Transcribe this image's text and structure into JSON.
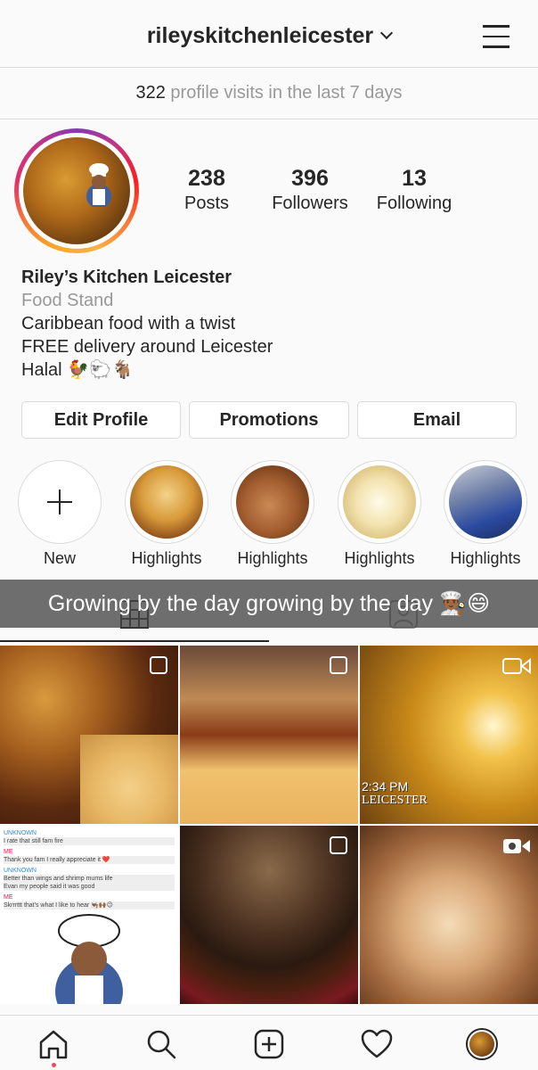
{
  "header": {
    "username": "rileyskitchenleicester"
  },
  "insights": {
    "count": "322",
    "text": "profile visits in the last 7 days"
  },
  "stats": [
    {
      "value": "238",
      "label": "Posts"
    },
    {
      "value": "396",
      "label": "Followers"
    },
    {
      "value": "13",
      "label": "Following"
    }
  ],
  "bio": {
    "name": "Riley’s Kitchen Leicester",
    "category": "Food Stand",
    "lines": [
      "Caribbean food with a twist",
      "FREE delivery around Leicester",
      "Halal 🐓🐑🐐"
    ]
  },
  "buttons": {
    "edit": "Edit Profile",
    "promotions": "Promotions",
    "email": "Email"
  },
  "highlights": [
    {
      "label": "New"
    },
    {
      "label": "Highlights"
    },
    {
      "label": "Highlights"
    },
    {
      "label": "Highlights"
    },
    {
      "label": "Highlights"
    }
  ],
  "caption": "Growing by the day growing by the day 👨🏾‍🍳😄",
  "grid_overlays": {
    "timestamp": "2:34 PM",
    "location": "LEICESTER",
    "chat": [
      {
        "sender": "UNKNOWN",
        "text": "I rate that still fam fire"
      },
      {
        "sender": "ME",
        "text": "Thank you fam I really appreciate it ❤️"
      },
      {
        "sender": "UNKNOWN",
        "text": "Better than wings and shrimp mums life"
      },
      {
        "sender": "",
        "text": "Evan my people said it was good"
      },
      {
        "sender": "ME",
        "text": "Skrrrttt that's what I like to hear 👨🏾‍🍳🙌🏾😉"
      }
    ]
  },
  "colors": {
    "text": "#262626",
    "muted": "#999999",
    "border": "#dbdbdb",
    "notify": "#ed4956"
  },
  "icons": [
    "chevron-down-icon",
    "menu-icon",
    "plus-icon",
    "grid-icon",
    "tagged-icon",
    "carousel-icon",
    "video-icon",
    "home-icon",
    "search-icon",
    "new-post-icon",
    "heart-icon",
    "profile-avatar-icon"
  ]
}
